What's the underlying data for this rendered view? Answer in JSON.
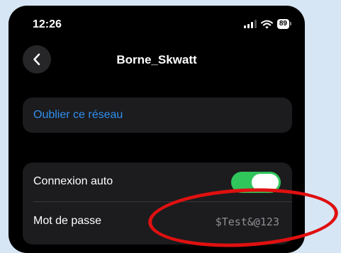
{
  "status_bar": {
    "time": "12:26",
    "battery": "89"
  },
  "header": {
    "back_icon": "chevron-left-icon",
    "title": "Borne_Skwatt"
  },
  "forget_network": {
    "label": "Oublier ce réseau",
    "color": "#2f8ff0"
  },
  "settings": {
    "auto_connect": {
      "label": "Connexion auto",
      "enabled": true,
      "accent": "#30c65c"
    },
    "password": {
      "label": "Mot de passe",
      "value": "$Test&@123"
    }
  },
  "annotation": {
    "color": "#e01010"
  }
}
